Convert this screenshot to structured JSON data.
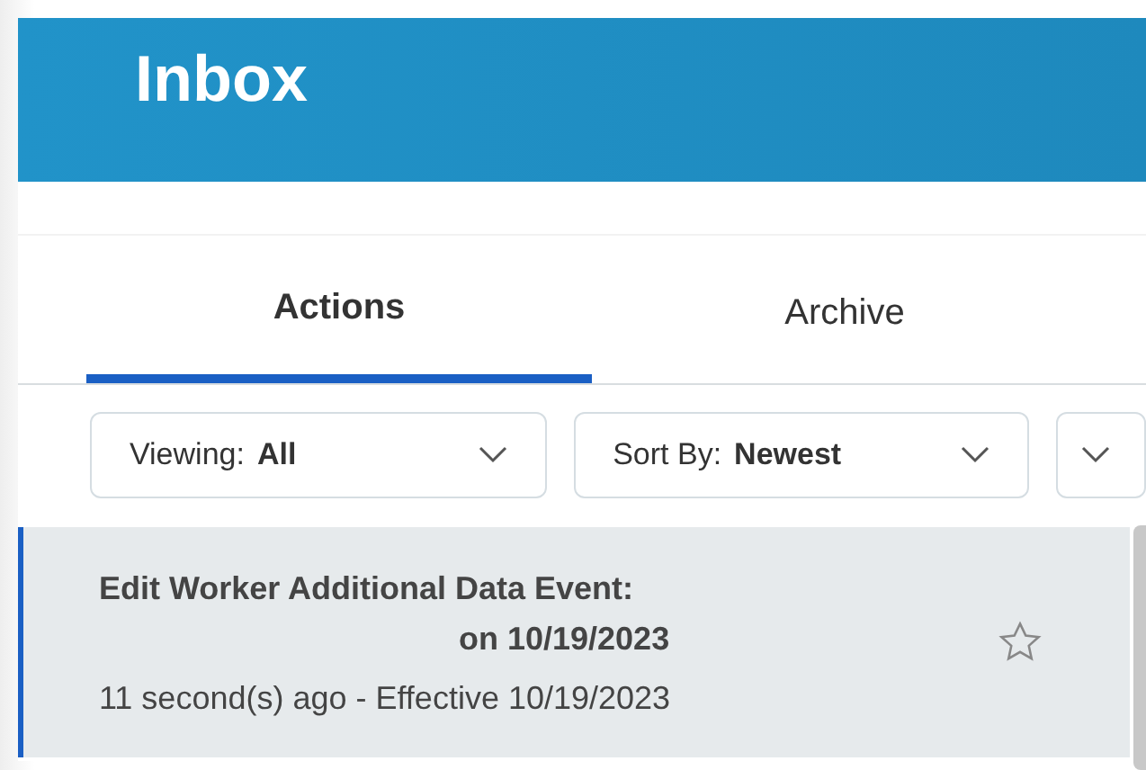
{
  "header": {
    "title": "Inbox"
  },
  "tabs": [
    {
      "label": "Actions",
      "selected": true
    },
    {
      "label": "Archive",
      "selected": false
    }
  ],
  "filters": [
    {
      "label": "Viewing:",
      "value": "All"
    },
    {
      "label": "Sort By:",
      "value": "Newest"
    }
  ],
  "items": [
    {
      "title_lines": [
        "Edit Worker Additional Data Event:",
        "on 10/19/2023"
      ],
      "subtitle": "11 second(s) ago - Effective 10/19/2023",
      "selected": true,
      "starred": false
    }
  ]
}
